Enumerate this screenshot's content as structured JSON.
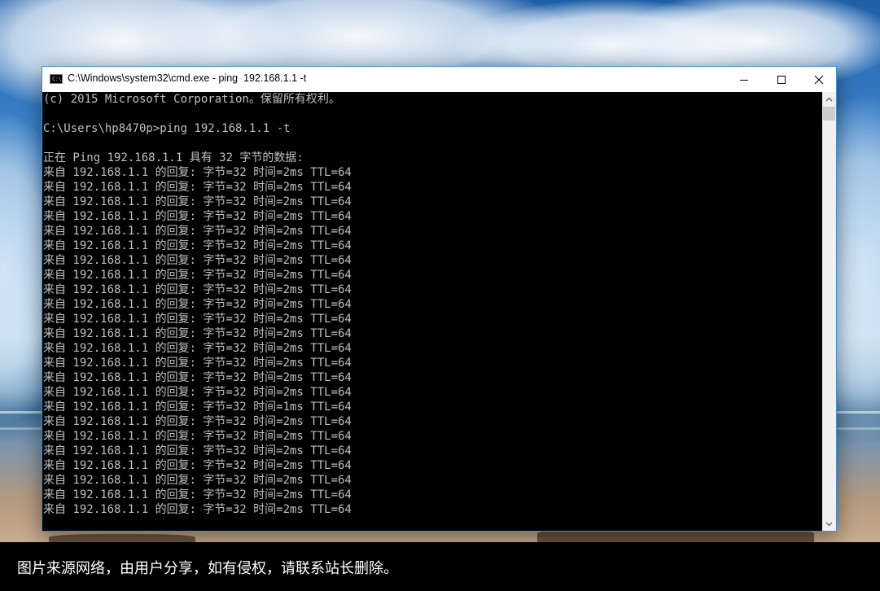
{
  "window": {
    "icon_text": "C:\\",
    "title": "C:\\Windows\\system32\\cmd.exe - ping  192.168.1.1 -t",
    "buttons": {
      "minimize": "minimize-icon",
      "maximize": "maximize-icon",
      "close": "close-icon"
    }
  },
  "console": {
    "lines": [
      "(c) 2015 Microsoft Corporation。保留所有权利。",
      "",
      "C:\\Users\\hp8470p>ping 192.168.1.1 -t",
      "",
      "正在 Ping 192.168.1.1 具有 32 字节的数据:",
      "来自 192.168.1.1 的回复: 字节=32 时间=2ms TTL=64",
      "来自 192.168.1.1 的回复: 字节=32 时间=2ms TTL=64",
      "来自 192.168.1.1 的回复: 字节=32 时间=2ms TTL=64",
      "来自 192.168.1.1 的回复: 字节=32 时间=2ms TTL=64",
      "来自 192.168.1.1 的回复: 字节=32 时间=2ms TTL=64",
      "来自 192.168.1.1 的回复: 字节=32 时间=2ms TTL=64",
      "来自 192.168.1.1 的回复: 字节=32 时间=2ms TTL=64",
      "来自 192.168.1.1 的回复: 字节=32 时间=2ms TTL=64",
      "来自 192.168.1.1 的回复: 字节=32 时间=2ms TTL=64",
      "来自 192.168.1.1 的回复: 字节=32 时间=2ms TTL=64",
      "来自 192.168.1.1 的回复: 字节=32 时间=2ms TTL=64",
      "来自 192.168.1.1 的回复: 字节=32 时间=2ms TTL=64",
      "来自 192.168.1.1 的回复: 字节=32 时间=2ms TTL=64",
      "来自 192.168.1.1 的回复: 字节=32 时间=2ms TTL=64",
      "来自 192.168.1.1 的回复: 字节=32 时间=2ms TTL=64",
      "来自 192.168.1.1 的回复: 字节=32 时间=2ms TTL=64",
      "来自 192.168.1.1 的回复: 字节=32 时间=1ms TTL=64",
      "来自 192.168.1.1 的回复: 字节=32 时间=2ms TTL=64",
      "来自 192.168.1.1 的回复: 字节=32 时间=2ms TTL=64",
      "来自 192.168.1.1 的回复: 字节=32 时间=2ms TTL=64",
      "来自 192.168.1.1 的回复: 字节=32 时间=2ms TTL=64",
      "来自 192.168.1.1 的回复: 字节=32 时间=2ms TTL=64",
      "来自 192.168.1.1 的回复: 字节=32 时间=2ms TTL=64",
      "来自 192.168.1.1 的回复: 字节=32 时间=2ms TTL=64"
    ],
    "colors": {
      "background": "#000000",
      "foreground": "#c0c0c0"
    }
  },
  "scrollbar": {
    "up_icon": "chevron-up-icon",
    "down_icon": "chevron-down-icon"
  },
  "caption": {
    "text": "图片来源网络，由用户分享，如有侵权，请联系站长删除。"
  }
}
